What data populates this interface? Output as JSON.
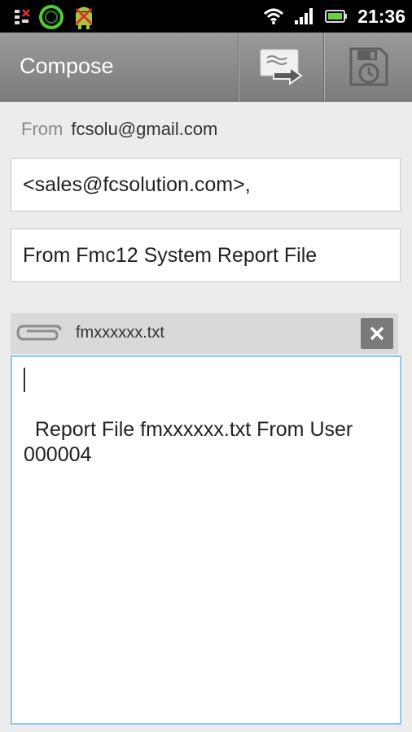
{
  "status_bar": {
    "time": "21:36",
    "icons": [
      "notification-x-icon",
      "sync-circle-icon",
      "android-debug-icon",
      "wifi-icon",
      "signal-icon",
      "battery-icon"
    ],
    "colors": {
      "background": "#000000",
      "ring": "#4ccf2e",
      "battery": "#6ccf3e"
    }
  },
  "action_bar": {
    "title": "Compose",
    "send_icon": "send-mail-icon",
    "save_icon": "save-draft-icon"
  },
  "compose": {
    "from_label": "From",
    "from_value": "fcsolu@gmail.com",
    "to_value": "<sales@fcsolution.com>,",
    "subject_value": "From Fmc12 System Report File",
    "attachment_name": "fmxxxxxx.txt",
    "body_value": "Report File fmxxxxxx.txt From User\n000004",
    "colors": {
      "body_border": "#8ec9ee"
    }
  }
}
